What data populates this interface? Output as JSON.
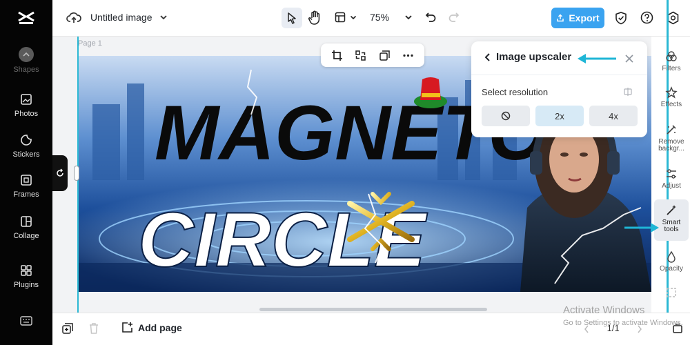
{
  "sidebar": {
    "items": [
      {
        "label": "Shapes",
        "icon": "shapes-icon"
      },
      {
        "label": "Photos",
        "icon": "photos-icon"
      },
      {
        "label": "Stickers",
        "icon": "stickers-icon"
      },
      {
        "label": "Frames",
        "icon": "frames-icon"
      },
      {
        "label": "Collage",
        "icon": "collage-icon"
      },
      {
        "label": "Plugins",
        "icon": "plugins-icon"
      }
    ]
  },
  "topbar": {
    "doc_title": "Untitled image",
    "zoom": "75%",
    "export_label": "Export"
  },
  "canvas": {
    "page_label": "Page 1",
    "artwork": {
      "line1": "MAGNETO",
      "line2": "CIRCLE"
    }
  },
  "upscaler": {
    "title": "Image upscaler",
    "resolution_label": "Select resolution",
    "options": [
      "2x",
      "4x"
    ],
    "selected": "2x"
  },
  "rail": {
    "items": [
      "Filters",
      "Effects",
      "Remove backgr...",
      "Adjust",
      "Smart tools",
      "Opacity"
    ]
  },
  "bottombar": {
    "add_page_label": "Add page",
    "page_indicator": "1/1"
  },
  "watermark": {
    "line1": "Activate Windows",
    "line2": "Go to Settings to activate Windows."
  },
  "colors": {
    "accent": "#3aa3f0",
    "annotation": "#1fb6d6",
    "sidebar_bg": "#050505"
  }
}
